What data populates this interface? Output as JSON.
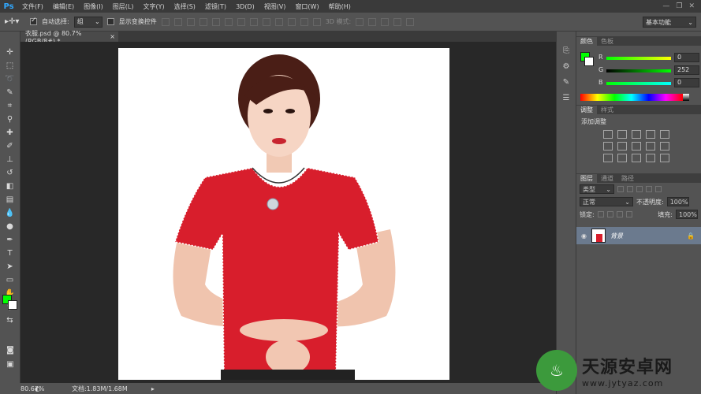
{
  "menubar": {
    "logo": "Ps",
    "items": [
      "文件(F)",
      "编辑(E)",
      "图像(I)",
      "图层(L)",
      "文字(Y)",
      "选择(S)",
      "滤镜(T)",
      "3D(D)",
      "视图(V)",
      "窗口(W)",
      "帮助(H)"
    ]
  },
  "options": {
    "auto_select_label": "自动选择:",
    "auto_select_value": "组",
    "show_transform_label": "显示变换控件",
    "mode3d_label": "3D 模式:",
    "workspace": "基本功能"
  },
  "document": {
    "tab_title": "衣服.psd @ 80.7%(RGB/8#) *",
    "zoom": "80.67%",
    "doc_info": "文档:1.83M/1.68M"
  },
  "color_panel": {
    "tabs": [
      "颜色",
      "色板"
    ],
    "r_label": "R",
    "g_label": "G",
    "b_label": "B",
    "r": "0",
    "g": "252",
    "b": "0",
    "foreground": "#00ff00",
    "background": "#ffffff"
  },
  "adjust_panel": {
    "tabs": [
      "调整",
      "样式"
    ],
    "title": "添加调整"
  },
  "layers_panel": {
    "tabs": [
      "图层",
      "通道",
      "路径"
    ],
    "filter_label": "类型",
    "blend_mode": "正常",
    "opacity_label": "不透明度:",
    "opacity": "100%",
    "lock_label": "锁定:",
    "fill_label": "填充:",
    "fill": "100%",
    "layer_name": "背景"
  },
  "watermark": {
    "brand": "天源安卓网",
    "url": "www.jytyaz.com"
  }
}
